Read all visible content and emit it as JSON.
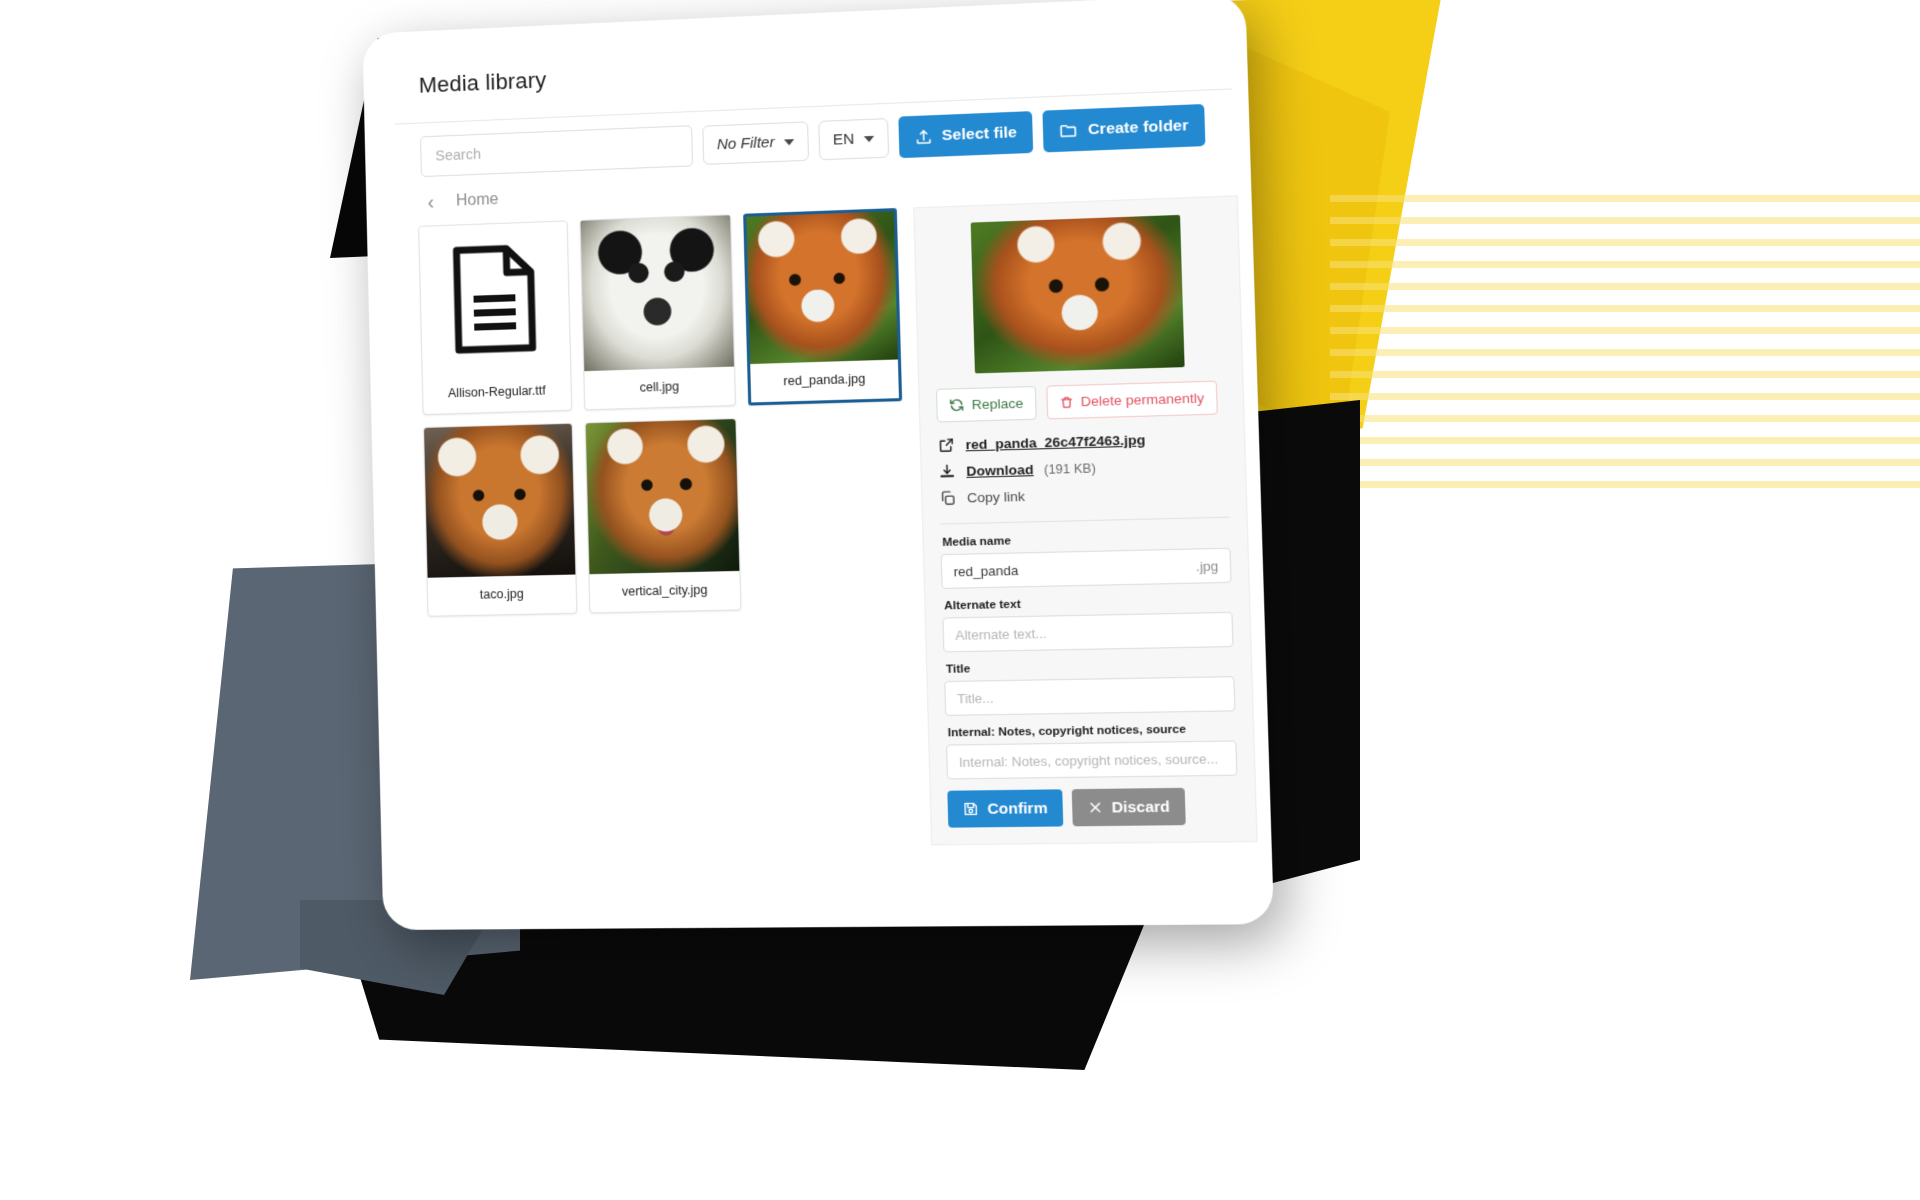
{
  "dialog": {
    "title": "Media library"
  },
  "toolbar": {
    "search_placeholder": "Search",
    "filter_label": "No Filter",
    "language_label": "EN",
    "select_file_label": "Select file",
    "create_folder_label": "Create folder"
  },
  "breadcrumb": {
    "back_glyph": "‹",
    "current": "Home"
  },
  "files": [
    {
      "name": "Allison-Regular.ttf",
      "kind": "font",
      "selected": false
    },
    {
      "name": "cell.jpg",
      "kind": "image-panda",
      "selected": false
    },
    {
      "name": "red_panda.jpg",
      "kind": "image-redpanda-leaves",
      "selected": true
    },
    {
      "name": "taco.jpg",
      "kind": "image-redpanda-rock",
      "selected": false
    },
    {
      "name": "vertical_city.jpg",
      "kind": "image-redpanda-open",
      "selected": false
    }
  ],
  "detail": {
    "replace_label": "Replace",
    "delete_label": "Delete permanently",
    "file_link": "red_panda_26c47f2463.jpg",
    "download_label": "Download",
    "download_size": "(191 KB)",
    "copy_link_label": "Copy link",
    "fields": {
      "media_name_label": "Media name",
      "media_name_value": "red_panda",
      "media_name_suffix": ".jpg",
      "alt_text_label": "Alternate text",
      "alt_text_placeholder": "Alternate text...",
      "title_label": "Title",
      "title_placeholder": "Title...",
      "internal_label": "Internal: Notes, copyright notices, source",
      "internal_placeholder": "Internal: Notes, copyright notices, source..."
    },
    "confirm_label": "Confirm",
    "discard_label": "Discard"
  },
  "colors": {
    "accent_blue": "#2389D1",
    "selected_border": "#1B5E93",
    "danger_red": "#E15361",
    "success_green": "#3C7A47",
    "discard_gray": "#8C8C8C",
    "deco_yellow": "#F5CE16",
    "deco_slate": "#5A6673"
  }
}
